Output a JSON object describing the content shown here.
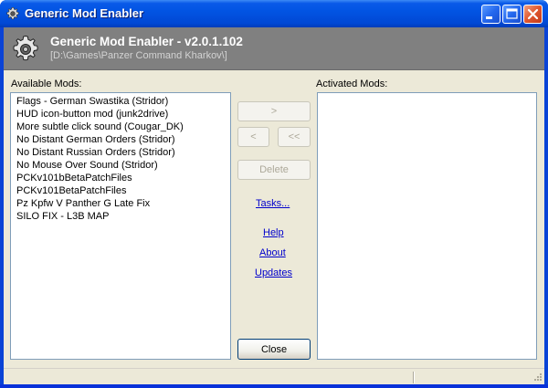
{
  "window": {
    "title": "Generic Mod Enabler",
    "title_icon": "gear-icon",
    "controls": [
      "minimize",
      "maximize",
      "close"
    ]
  },
  "header": {
    "title": "Generic Mod Enabler - v2.0.1.102",
    "path": "[D:\\Games\\Panzer Command Kharkov\\]",
    "icon": "gear-icon"
  },
  "available": {
    "label": "Available Mods:",
    "items": [
      "Flags - German Swastika (Stridor)",
      "HUD icon-button mod (junk2drive)",
      "More subtle click sound (Cougar_DK)",
      "No Distant German Orders (Stridor)",
      "No Distant Russian Orders  (Stridor)",
      "No Mouse Over Sound  (Stridor)",
      "PCKv101bBetaPatchFiles",
      "PCKv101BetaPatchFiles",
      "Pz Kpfw V Panther G Late Fix",
      "SILO FIX - L3B MAP"
    ]
  },
  "activated": {
    "label": "Activated Mods:",
    "items": []
  },
  "buttons": {
    "activate": ">",
    "deactivate": "<",
    "deactivate_all": "<<",
    "delete": "Delete",
    "close": "Close"
  },
  "links": {
    "tasks": "Tasks...",
    "help": "Help",
    "about": "About",
    "updates": "Updates"
  },
  "colors": {
    "titlebar": "#0054e3",
    "header_bg": "#808080",
    "dialog_bg": "#ece9d8",
    "link": "#0000cc"
  }
}
